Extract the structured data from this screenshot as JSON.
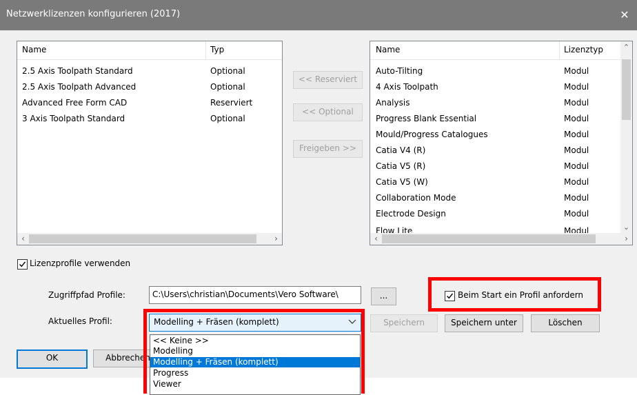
{
  "window": {
    "title": "Netzwerklizenzen konfigurieren (2017)",
    "close_glyph": "✕"
  },
  "left_list": {
    "headers": {
      "name": "Name",
      "type": "Typ"
    },
    "rows": [
      {
        "name": "2.5 Axis Toolpath Standard",
        "type": "Optional"
      },
      {
        "name": "2.5 Axis Toolpath Advanced",
        "type": "Optional"
      },
      {
        "name": "Advanced Free Form CAD",
        "type": "Reserviert"
      },
      {
        "name": "3 Axis Toolpath Standard",
        "type": "Optional"
      }
    ]
  },
  "middle_buttons": {
    "reserve": "<< Reserviert",
    "optional": "<< Optional",
    "release": "Freigeben >>"
  },
  "right_list": {
    "headers": {
      "name": "Name",
      "type": "Lizenztyp"
    },
    "rows": [
      {
        "name": "Auto-Tilting",
        "type": "Modul"
      },
      {
        "name": "4 Axis Toolpath",
        "type": "Modul"
      },
      {
        "name": "Analysis",
        "type": "Modul"
      },
      {
        "name": "Progress Blank Essential",
        "type": "Modul"
      },
      {
        "name": "Mould/Progress Catalogues",
        "type": "Modul"
      },
      {
        "name": "Catia V4 (R)",
        "type": "Modul"
      },
      {
        "name": "Catia V5 (R)",
        "type": "Modul"
      },
      {
        "name": "Catia V5 (W)",
        "type": "Modul"
      },
      {
        "name": "Collaboration Mode",
        "type": "Modul"
      },
      {
        "name": "Electrode Design",
        "type": "Modul"
      },
      {
        "name": "Flow Lite",
        "type": "Modul"
      }
    ]
  },
  "use_profiles": {
    "label": "Lizenzprofile verwenden",
    "checked": true
  },
  "access_path": {
    "label": "Zugriffpfad Profile:",
    "value": "C:\\Users\\christian\\Documents\\Vero Software\\",
    "browse_label": "..."
  },
  "request_profile": {
    "label": "Beim Start ein Profil anfordern",
    "checked": true
  },
  "current_profile": {
    "label": "Aktuelles Profil:",
    "value": "Modelling + Fräsen (komplett)",
    "options": [
      "<< Keine >>",
      "Modelling",
      "Modelling + Fräsen (komplett)",
      "Progress",
      "Viewer"
    ],
    "selected_index": 2
  },
  "profile_buttons": {
    "save": "Speichern",
    "save_as": "Speichern unter",
    "delete": "Löschen"
  },
  "footer_buttons": {
    "ok": "OK",
    "cancel": "Abbrechen"
  },
  "colors": {
    "highlight": "#ff0000",
    "accent": "#0078d7"
  }
}
